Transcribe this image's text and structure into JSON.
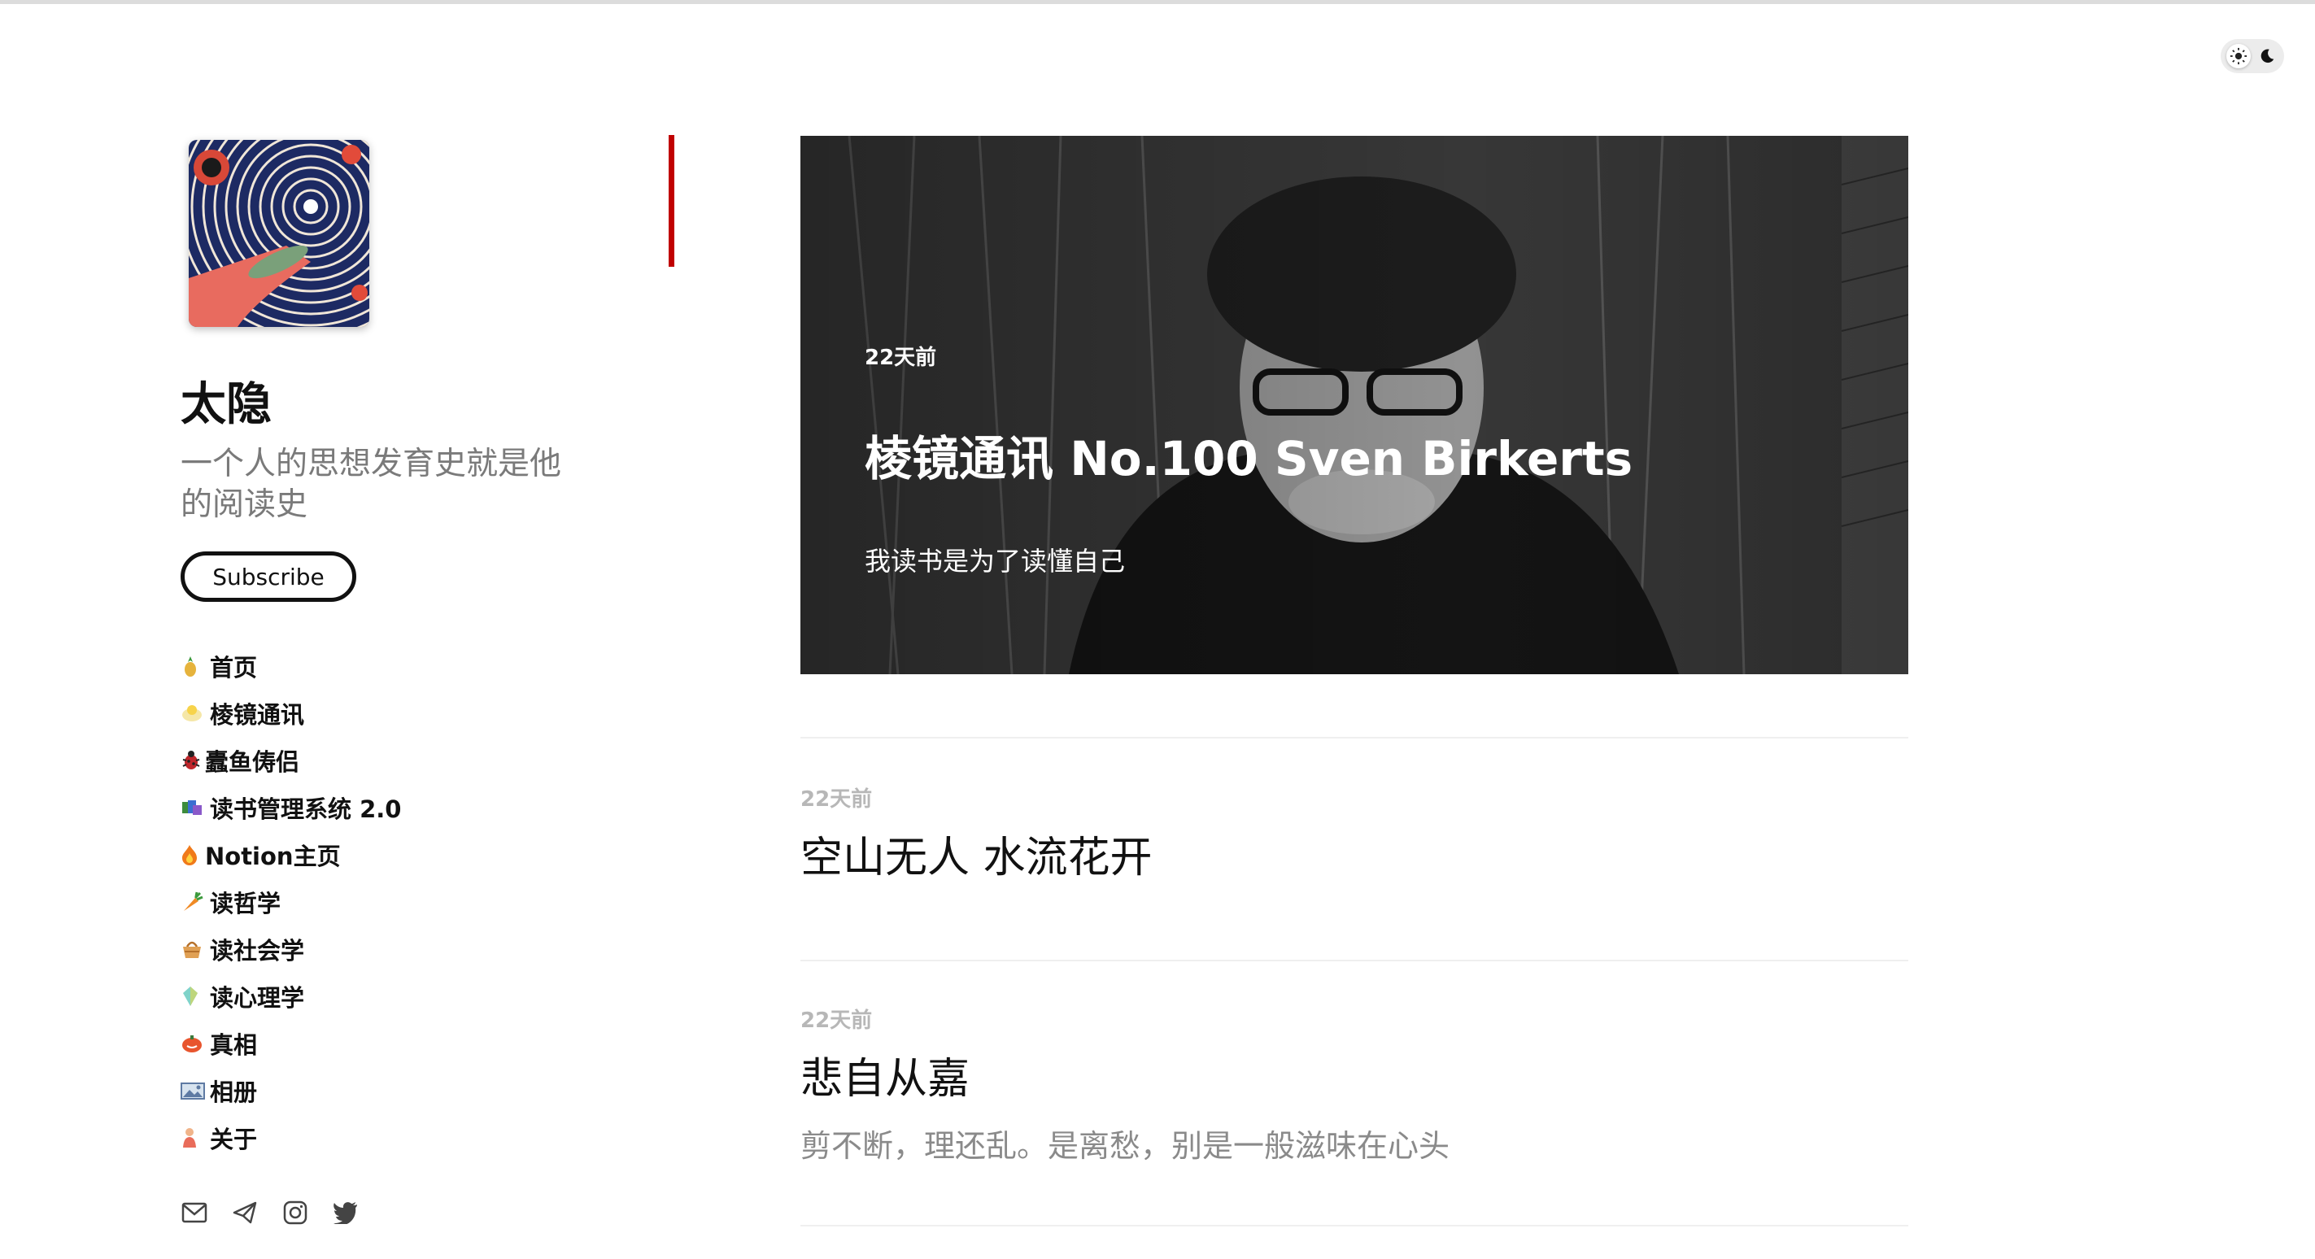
{
  "site": {
    "title": "太隐",
    "description": "一个人的思想发育史就是他的阅读史",
    "subscribe_label": "Subscribe"
  },
  "nav": [
    {
      "icon": "pineapple-icon",
      "label": "首页"
    },
    {
      "icon": "chick-icon",
      "label": "棱镜通讯"
    },
    {
      "icon": "bug-icon",
      "label": "蠹鱼俦侣"
    },
    {
      "icon": "books-icon",
      "label": "读书管理系统 2.0"
    },
    {
      "icon": "fire-icon",
      "label": "Notion主页"
    },
    {
      "icon": "carrot-icon",
      "label": "读哲学"
    },
    {
      "icon": "basket-icon",
      "label": "读社会学"
    },
    {
      "icon": "crystal-icon",
      "label": "读心理学"
    },
    {
      "icon": "pumpkin-icon",
      "label": "真相"
    },
    {
      "icon": "photo-album-icon",
      "label": "相册"
    },
    {
      "icon": "person-icon",
      "label": "关于"
    }
  ],
  "socials": [
    "email-icon",
    "telegram-icon",
    "instagram-icon",
    "twitter-icon"
  ],
  "featured": {
    "date": "22天前",
    "title": "棱镜通讯 No.100 Sven Birkerts",
    "excerpt": "我读书是为了读懂自己"
  },
  "posts": [
    {
      "date": "22天前",
      "title": "空山无人 水流花开",
      "excerpt": ""
    },
    {
      "date": "22天前",
      "title": "悲自从嘉",
      "excerpt": "剪不断，理还乱。是离愁，别是一般滋味在心头"
    }
  ],
  "colors": {
    "accent": "#c00000",
    "text": "#111111",
    "muted": "#8a8a8a"
  }
}
